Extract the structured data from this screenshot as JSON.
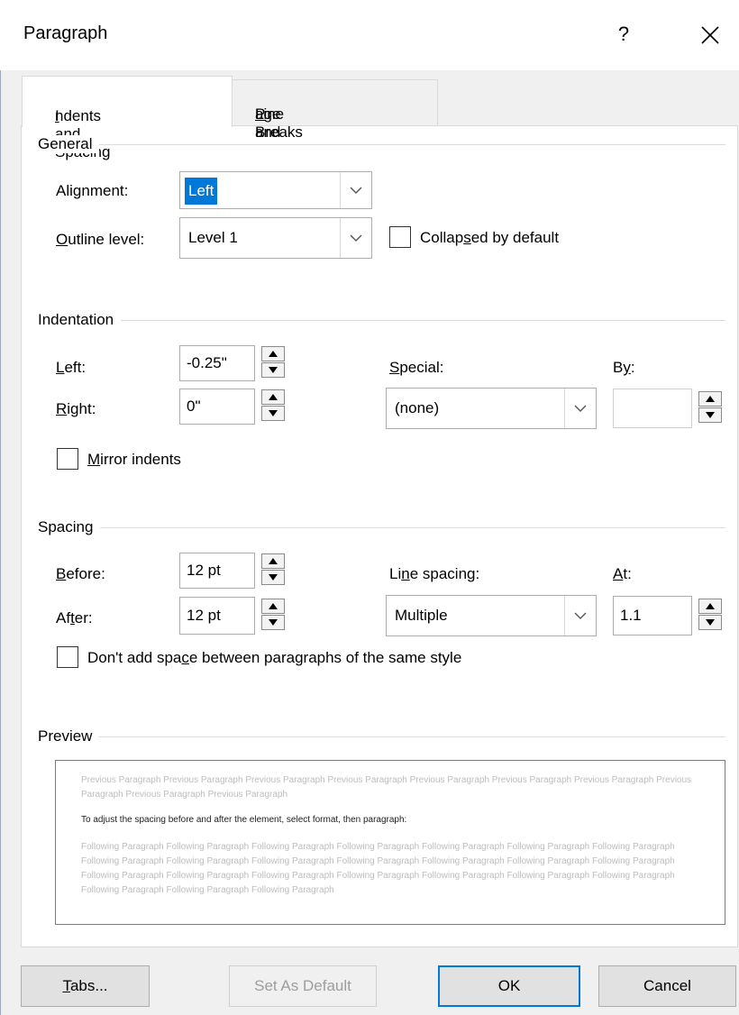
{
  "window": {
    "title": "Paragraph",
    "help_glyph": "?",
    "close_icon": "close-x-icon"
  },
  "tabs": [
    {
      "pre": "",
      "key": "I",
      "post": "ndents and Spacing",
      "active": true
    },
    {
      "pre": "Line and ",
      "key": "P",
      "post": "age Breaks",
      "active": false
    }
  ],
  "general": {
    "title": "General",
    "alignment": {
      "pre": "Ali",
      "key": "g",
      "post": "nment:",
      "value": "Left"
    },
    "outline": {
      "pre": "",
      "key": "O",
      "post": "utline level:",
      "value": "Level 1"
    },
    "collapsed": {
      "pre": "Collap",
      "key": "s",
      "post": "ed by default",
      "checked": false
    }
  },
  "indentation": {
    "title": "Indentation",
    "left": {
      "pre": "",
      "key": "L",
      "post": "eft:",
      "value": "-0.25\""
    },
    "right": {
      "pre": "",
      "key": "R",
      "post": "ight:",
      "value": "0\""
    },
    "special": {
      "pre": "",
      "key": "S",
      "post": "pecial:",
      "value": "(none)"
    },
    "by": {
      "pre": "B",
      "key": "y",
      "post": ":",
      "value": ""
    },
    "mirror": {
      "pre": "",
      "key": "M",
      "post": "irror indents",
      "checked": false
    }
  },
  "spacing": {
    "title": "Spacing",
    "before": {
      "pre": "",
      "key": "B",
      "post": "efore:",
      "value": "12 pt"
    },
    "after": {
      "pre": "Af",
      "key": "t",
      "post": "er:",
      "value": "12 pt"
    },
    "line_spacing": {
      "pre": "Li",
      "key": "n",
      "post": "e spacing:",
      "value": "Multiple"
    },
    "at": {
      "pre": "",
      "key": "A",
      "post": "t:",
      "value": "1.1"
    },
    "dont_add": {
      "pre": "Don't add spa",
      "key": "c",
      "post": "e between paragraphs of the same style",
      "checked": false
    }
  },
  "preview": {
    "title": "Preview",
    "previous": "Previous Paragraph Previous Paragraph Previous Paragraph Previous Paragraph Previous Paragraph Previous Paragraph Previous Paragraph Previous Paragraph Previous Paragraph Previous Paragraph",
    "current": "To adjust the spacing before and after the element, select format, then paragraph:",
    "following": "Following Paragraph Following Paragraph Following Paragraph Following Paragraph Following Paragraph Following Paragraph Following Paragraph Following Paragraph Following Paragraph Following Paragraph Following Paragraph Following Paragraph Following Paragraph Following Paragraph Following Paragraph Following Paragraph Following Paragraph Following Paragraph Following Paragraph Following Paragraph Following Paragraph Following Paragraph Following Paragraph Following Paragraph"
  },
  "buttons": {
    "tabs": {
      "pre": "",
      "key": "T",
      "post": "abs..."
    },
    "set_default": "Set As Default",
    "ok": "OK",
    "cancel": "Cancel"
  },
  "colors": {
    "accent": "#0078d7",
    "dialog_bg": "#f0f0f0",
    "panel_bg": "#ffffff"
  }
}
